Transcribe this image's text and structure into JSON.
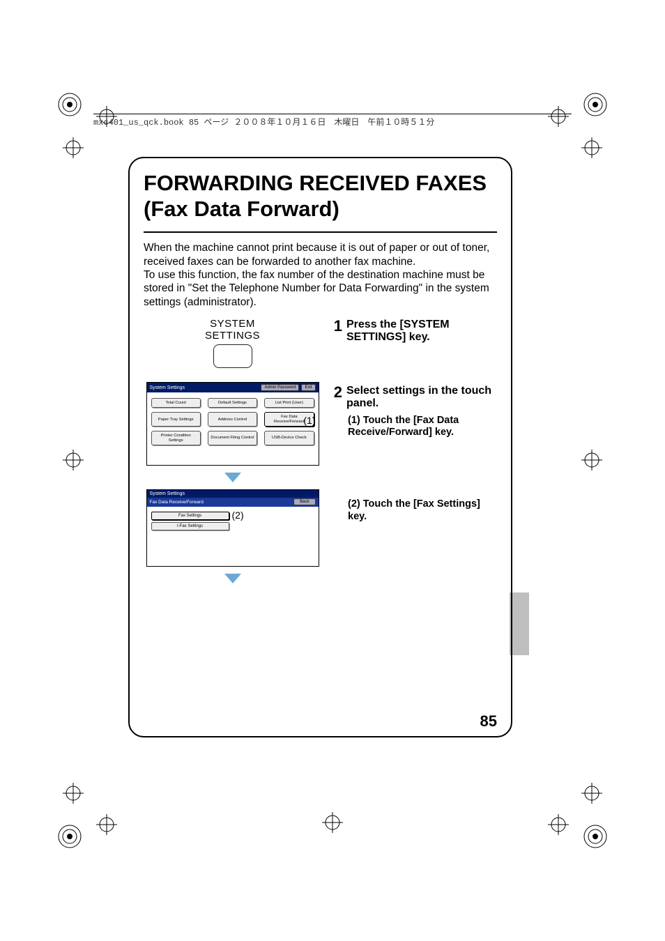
{
  "header": {
    "text": "mxc401_us_qck.book  85 ページ  ２００８年１０月１６日　木曜日　午前１０時５１分"
  },
  "title": "FORWARDING RECEIVED FAXES (Fax Data Forward)",
  "intro": "When the machine cannot print because it is out of paper or out of toner, received faxes can be forwarded to another fax machine.\nTo use this function, the fax number of the destination machine must be stored in \"Set the Telephone Number for Data Forwarding\" in the system settings (administrator).",
  "sys_key": {
    "line1": "SYSTEM",
    "line2": "SETTINGS"
  },
  "steps": [
    {
      "num": "1",
      "title": "Press the [SYSTEM SETTINGS] key."
    },
    {
      "num": "2",
      "title": "Select settings in the touch panel.",
      "subs": [
        "(1) Touch the [Fax Data Receive/Forward] key.",
        "(2) Touch the [Fax Settings] key."
      ]
    }
  ],
  "annot": {
    "one": "(1)",
    "two": "(2)"
  },
  "panel1": {
    "title": "System Settings",
    "admin": "Admin Password",
    "exit": "Exit",
    "buttons": [
      "Total Count",
      "Default Settings",
      "List Print (User)",
      "Paper Tray Settings",
      "Address Control",
      "Fax Data Receive/Forward",
      "Printer Condition Settings",
      "Document Filing Control",
      "USB-Device Check"
    ]
  },
  "panel2": {
    "title": "System Settings",
    "sub": "Fax Data Receive/Forward",
    "back": "Back",
    "rows": [
      "Fax Settings",
      "I-Fax Settings"
    ]
  },
  "page_number": "85"
}
